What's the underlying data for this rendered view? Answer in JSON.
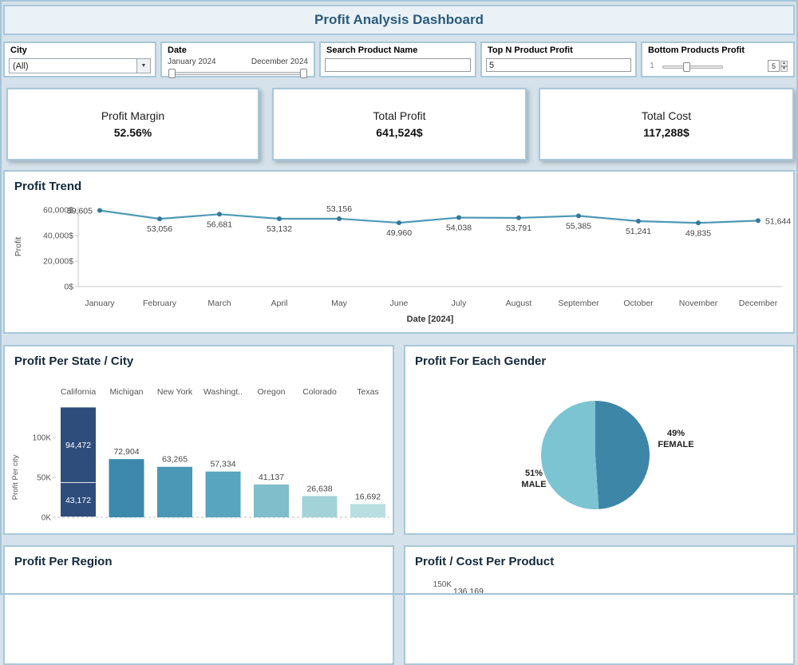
{
  "header": {
    "title": "Profit Analysis Dashboard"
  },
  "filters": {
    "city": {
      "label": "City",
      "value": "(All)"
    },
    "date": {
      "label": "Date",
      "start": "January 2024",
      "end": "December 2024"
    },
    "search": {
      "label": "Search Product Name",
      "value": ""
    },
    "top_n": {
      "label": "Top N Product Profit",
      "value": "5"
    },
    "bottom": {
      "label": "Bottom Products Profit",
      "min": "1",
      "value": "5"
    }
  },
  "kpis": [
    {
      "label": "Profit Margin",
      "value": "52.56%"
    },
    {
      "label": "Total Profit",
      "value": "641,524$"
    },
    {
      "label": "Total Cost",
      "value": "117,288$"
    }
  ],
  "chart_data": [
    {
      "type": "line",
      "title": "Profit Trend",
      "x": [
        "January",
        "February",
        "March",
        "April",
        "May",
        "June",
        "July",
        "August",
        "September",
        "October",
        "November",
        "December"
      ],
      "values": [
        59605,
        53056,
        56681,
        53132,
        53156,
        49960,
        54038,
        53791,
        55385,
        51241,
        49835,
        51644
      ],
      "point_labels": [
        "59,605",
        "53,056",
        "56,681",
        "53,132",
        "53,156",
        "49,960",
        "54,038",
        "53,791",
        "55,385",
        "51,241",
        "49,835",
        "51,644"
      ],
      "xlabel": "Date [2024]",
      "ylabel": "Profit",
      "ylim": [
        0,
        60000
      ],
      "yticks": [
        {
          "v": 0,
          "label": "0$"
        },
        {
          "v": 20000,
          "label": "20,000$"
        },
        {
          "v": 40000,
          "label": "40,000$"
        },
        {
          "v": 60000,
          "label": "60,000$"
        }
      ],
      "line_color": "#4d99b7",
      "point_color": "#35789a"
    },
    {
      "type": "bar",
      "title": "Profit Per State / City",
      "categories": [
        "California",
        "Michigan",
        "New York",
        "Washingt..",
        "Oregon",
        "Colorado",
        "Texas"
      ],
      "values": [
        137644,
        72904,
        63265,
        57334,
        41137,
        26638,
        16692
      ],
      "bar_labels": [
        "",
        "72,904",
        "63,265",
        "57,334",
        "41,137",
        "26,638",
        "16,692"
      ],
      "stacked_first_bar": {
        "segments": [
          43172,
          94472
        ],
        "labels": [
          "43,172",
          "94,472"
        ]
      },
      "ylabel": "Profit Per city",
      "ylim": [
        0,
        150000
      ],
      "yticks": [
        {
          "v": 0,
          "label": "0K"
        },
        {
          "v": 50000,
          "label": "50K"
        },
        {
          "v": 100000,
          "label": "100K"
        }
      ],
      "colors": [
        "#2e4d7b",
        "#3d89ad",
        "#4b97b6",
        "#58a5bf",
        "#7fbeca",
        "#a3d3d8",
        "#b9dfe1"
      ]
    },
    {
      "type": "pie",
      "title": "Profit For Each Gender",
      "slices": [
        {
          "name": "FEMALE",
          "pct": 49,
          "pct_label": "49%",
          "color": "#3e86a7"
        },
        {
          "name": "MALE",
          "pct": 51,
          "pct_label": "51%",
          "color": "#7dc4d3"
        }
      ]
    },
    {
      "type": "bar",
      "title": "Profit Per Region"
    },
    {
      "type": "bar",
      "title": "Profit / Cost Per Product",
      "yticks": [
        {
          "v": 150000,
          "label": "150K"
        }
      ],
      "bar_labels": [
        "136,169"
      ]
    }
  ]
}
